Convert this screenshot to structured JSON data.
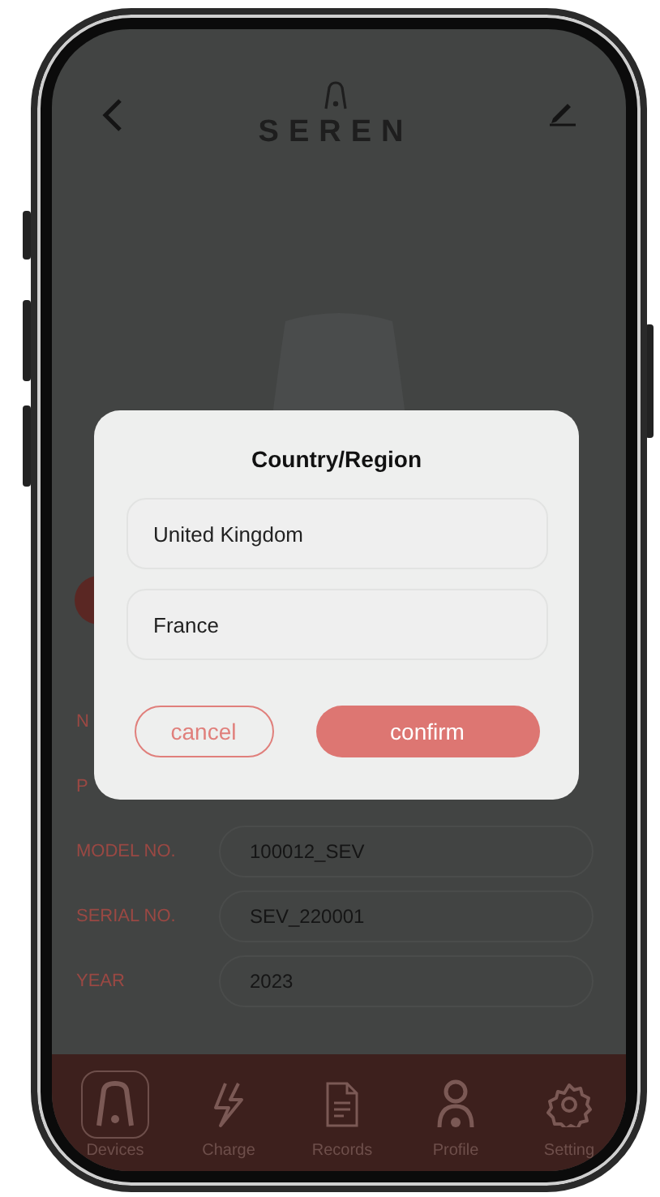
{
  "header": {
    "brand": "SEREN"
  },
  "details": [
    {
      "label": "N"
    },
    {
      "label": "P"
    },
    {
      "label": "MODEL NO.",
      "value": "100012_SEV"
    },
    {
      "label": "SERIAL NO.",
      "value": "SEV_220001"
    },
    {
      "label": "YEAR",
      "value": "2023"
    }
  ],
  "dialog": {
    "title": "Country/Region",
    "options": [
      "United Kingdom",
      "France"
    ],
    "buttons": [
      {
        "label": "cancel",
        "kind": "outline"
      },
      {
        "label": "confirm",
        "kind": "filled"
      }
    ]
  },
  "nav": [
    {
      "label": "Devices",
      "selected": true
    },
    {
      "label": "Charge",
      "selected": false
    },
    {
      "label": "Records",
      "selected": false
    },
    {
      "label": "Profile",
      "selected": false
    },
    {
      "label": "Setting",
      "selected": false
    }
  ]
}
